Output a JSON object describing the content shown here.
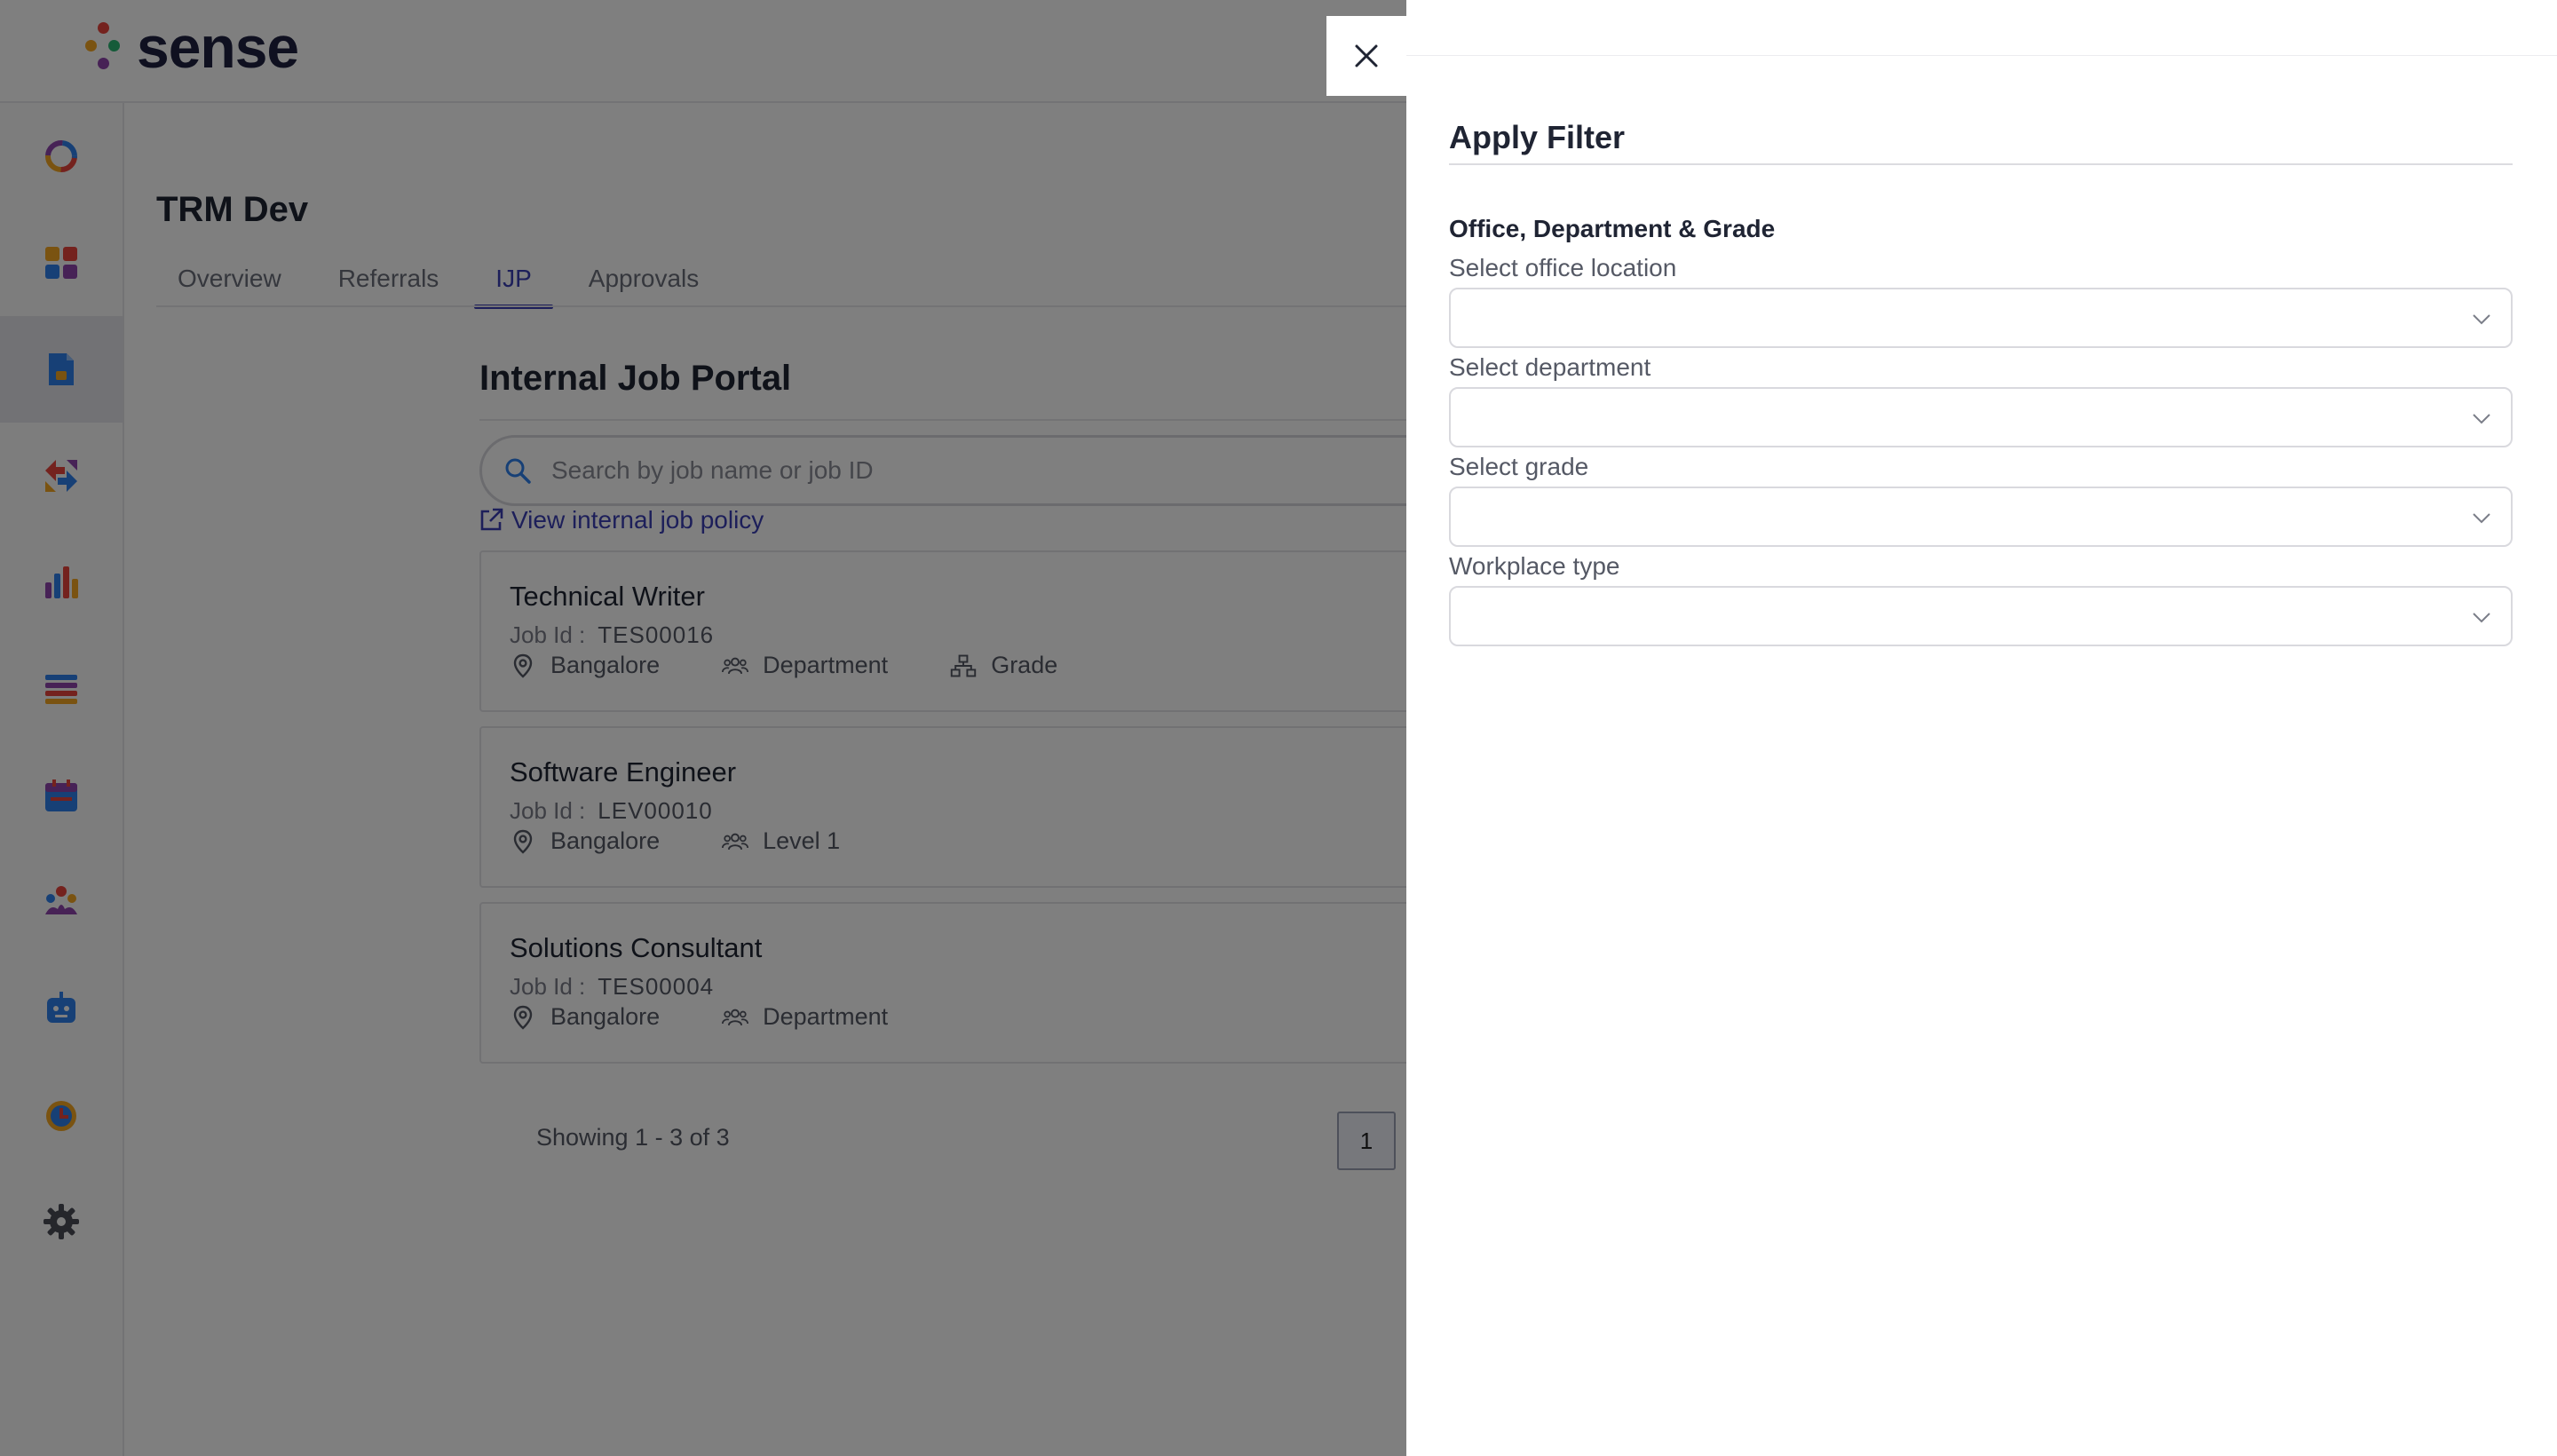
{
  "brand": {
    "name": "sense"
  },
  "sidebar": {
    "items": [
      {
        "icon": "ring-icon"
      },
      {
        "icon": "dashboard-icon"
      },
      {
        "icon": "jobs-document-icon",
        "active": true
      },
      {
        "icon": "referral-arrows-icon"
      },
      {
        "icon": "analytics-chart-icon"
      },
      {
        "icon": "list-icon"
      },
      {
        "icon": "calendar-icon"
      },
      {
        "icon": "people-icon"
      },
      {
        "icon": "bot-icon"
      },
      {
        "icon": "alarm-clock-icon"
      },
      {
        "icon": "settings-gear-icon"
      }
    ]
  },
  "page": {
    "title": "TRM Dev"
  },
  "tabs": [
    {
      "label": "Overview"
    },
    {
      "label": "Referrals"
    },
    {
      "label": "IJP",
      "active": true
    },
    {
      "label": "Approvals"
    }
  ],
  "portal": {
    "title": "Internal Job Portal",
    "search_placeholder": "Search by job name or job ID",
    "policy_link": "View internal job policy"
  },
  "jobs": [
    {
      "title": "Technical Writer",
      "id_label": "Job Id :",
      "id": "TES00016",
      "location": "Bangalore",
      "department": "Department",
      "grade": "Grade"
    },
    {
      "title": "Software Engineer",
      "id_label": "Job Id :",
      "id": "LEV00010",
      "location": "Bangalore",
      "department": "Level 1"
    },
    {
      "title": "Solutions Consultant",
      "id_label": "Job Id :",
      "id": "TES00004",
      "location": "Bangalore",
      "department": "Department"
    }
  ],
  "pagination": {
    "showing": "Showing 1 - 3 of 3",
    "current_page": "1"
  },
  "filter": {
    "title": "Apply Filter",
    "section_title": "Office, Department & Grade",
    "fields": [
      {
        "label": "Select office location",
        "value": ""
      },
      {
        "label": "Select department",
        "value": ""
      },
      {
        "label": "Select grade",
        "value": ""
      },
      {
        "label": "Workplace type",
        "value": ""
      }
    ]
  },
  "colors": {
    "accent": "#3a3fb5",
    "overlay": "rgba(0,0,0,0.5)",
    "logo_dots": [
      "#e8453c",
      "#f5a623",
      "#2bb673",
      "#2f80ed",
      "#8e44ad"
    ]
  }
}
